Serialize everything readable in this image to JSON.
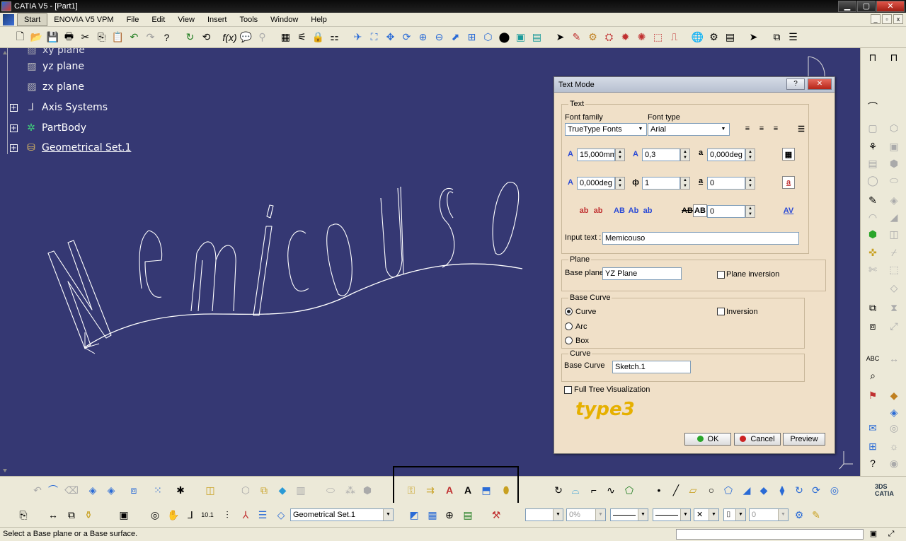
{
  "window": {
    "title": "CATIA V5 - [Part1]",
    "minimize": "▁",
    "restore": "▢",
    "close": "✕"
  },
  "menu": {
    "items": [
      "Start",
      "ENOVIA V5 VPM",
      "File",
      "Edit",
      "View",
      "Insert",
      "Tools",
      "Window",
      "Help"
    ],
    "mdi_min": "_",
    "mdi_restore": "▫",
    "mdi_close": "x"
  },
  "tree": {
    "items": [
      {
        "label": "yz plane",
        "expandable": false,
        "underline": false
      },
      {
        "label": "zx plane",
        "expandable": false,
        "underline": false
      },
      {
        "label": "Axis Systems",
        "expandable": true,
        "underline": false
      },
      {
        "label": "PartBody",
        "expandable": true,
        "underline": false
      },
      {
        "label": "Geometrical Set.1",
        "expandable": true,
        "underline": true
      }
    ],
    "top_partial": "xy plane"
  },
  "viewport": {
    "text_chars": [
      "M",
      "e",
      "m",
      "i",
      "c",
      "o",
      "u",
      "s",
      "o"
    ],
    "color_bg": "#353873"
  },
  "dialog": {
    "title": "Text Mode",
    "help_btn": "?",
    "close_btn": "✕",
    "text_group": "Text",
    "font_family_label": "Font family",
    "font_type_label": "Font type",
    "font_family_value": "TrueType Fonts",
    "font_type_value": "Arial",
    "height_value": "15,000mm",
    "ratio_value": "0,3",
    "angle1_value": "0,000deg",
    "slant_value": "0,000deg",
    "spacing_value": "1",
    "count_value": "0",
    "offset_value": "0",
    "input_text_label": "Input text :",
    "input_text_value": "Memicouso",
    "plane_group": "Plane",
    "base_plane_label": "Base plane",
    "base_plane_value": "YZ Plane",
    "plane_inversion_label": "Plane inversion",
    "base_curve_group": "Base Curve",
    "curve_option": "Curve",
    "arc_option": "Arc",
    "box_option": "Box",
    "inversion_label": "Inversion",
    "curve_group": "Curve",
    "base_curve_label": "Base Curve",
    "base_curve_value": "Sketch.1",
    "full_tree_label": "Full Tree Visualization",
    "logo_text": "type3",
    "ok_label": "OK",
    "cancel_label": "Cancel",
    "preview_label": "Preview"
  },
  "bottom": {
    "geometrical_set": "Geometrical Set.1",
    "percent": "0%",
    "zero_value": "0"
  },
  "status": {
    "message": "Select a Base plane or a Base surface."
  },
  "colors": {
    "accent_ok": "#2aa52a",
    "accent_cancel": "#cc2222",
    "dialog_bg": "#f0e0c8"
  }
}
